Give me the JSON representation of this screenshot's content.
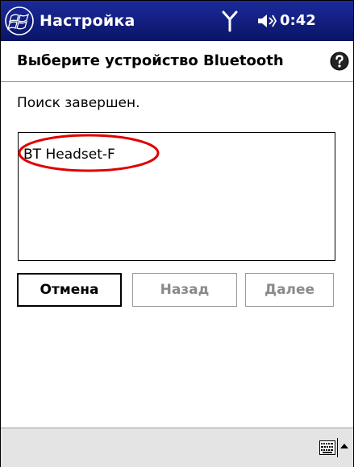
{
  "window": {
    "title": "Настройка",
    "clock": "0:42",
    "icons": {
      "start": "windows-start-icon",
      "connectivity": "antenna-icon",
      "volume": "volume-icon",
      "help": "help-icon",
      "keyboard": "keyboard-icon",
      "sip": "arrow-up-icon"
    }
  },
  "page": {
    "heading": "Выберите устройство Bluetooth",
    "status": "Поиск завершен."
  },
  "device_list": {
    "items": [
      {
        "label": "BT Headset-F",
        "highlighted": true
      }
    ]
  },
  "buttons": {
    "cancel": {
      "label": "Отмена",
      "enabled": true
    },
    "back": {
      "label": "Назад",
      "enabled": false
    },
    "next": {
      "label": "Далее",
      "enabled": false
    }
  },
  "colors": {
    "titlebar": "#0f1a7a",
    "highlight": "#e00000",
    "disabled_text": "#8a8a8a"
  }
}
